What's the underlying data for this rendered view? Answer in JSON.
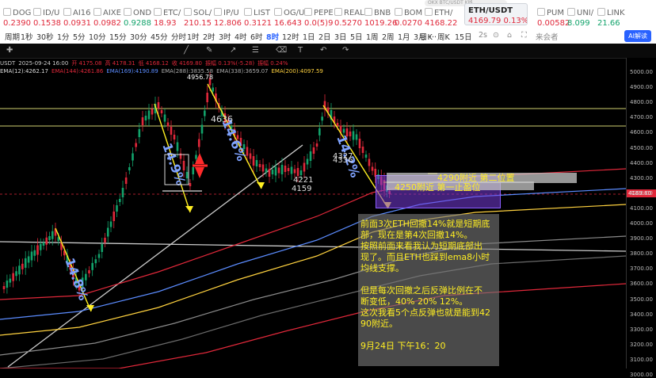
{
  "tickers": [
    {
      "sym": "DOG",
      "price": "0.2390",
      "dir": "dn"
    },
    {
      "sym": "ID/U",
      "price": "0.1538",
      "dir": "dn"
    },
    {
      "sym": "AI16",
      "price": "0.0931",
      "dir": "dn"
    },
    {
      "sym": "AIXE",
      "price": "0.0982",
      "dir": "dn"
    },
    {
      "sym": "OND",
      "price": "0.9288",
      "dir": "up"
    },
    {
      "sym": "ETC/",
      "price": "18.93",
      "dir": "dn"
    },
    {
      "sym": "SOL/",
      "price": "210.15",
      "dir": "dn"
    },
    {
      "sym": "IP/U",
      "price": "12.806",
      "dir": "dn"
    },
    {
      "sym": "LIST",
      "price": "0.3121",
      "dir": "dn"
    },
    {
      "sym": "OG/U",
      "price": "16.643",
      "dir": "dn"
    },
    {
      "sym": "PEPE",
      "price": "0.0(5)9",
      "dir": "dn"
    },
    {
      "sym": "REAL",
      "price": "0.5270",
      "dir": "dn"
    },
    {
      "sym": "BNB",
      "price": "1019.26",
      "dir": "dn"
    },
    {
      "sym": "BOM",
      "price": "0.0270",
      "dir": "dn"
    },
    {
      "sym": "ETH/",
      "price": "4168.22",
      "dir": "dn"
    },
    {
      "sym": "ETH/USDT",
      "price": "4169.79",
      "change": "0.13%",
      "dir": "dn",
      "active": true
    },
    {
      "sym": "PUM",
      "price": "0.00582",
      "dir": "dn"
    },
    {
      "sym": "UNI/",
      "price": "8.099",
      "dir": "up"
    },
    {
      "sym": "LINK",
      "price": "21.66",
      "dir": "up"
    }
  ],
  "url_hint": "OKX BTC/USDT K线",
  "toolbar": {
    "items": [
      "周期",
      "1秒",
      "30秒",
      "1分",
      "5分",
      "10分",
      "15分",
      "30分",
      "45分",
      "分时",
      "1时",
      "2时",
      "3时",
      "4时",
      "6时",
      "8时",
      "12时",
      "1日",
      "2日",
      "3日",
      "5日",
      "1周",
      "2周",
      "1月",
      "3月",
      "..."
    ],
    "items2": [
      "日K",
      "周K",
      "15日"
    ],
    "selected": "8时",
    "right": [
      "2s",
      "⊙",
      "⌂",
      "⛶",
      "来会者"
    ],
    "ai": "AI解读"
  },
  "info": {
    "line1": [
      "USDT",
      "2025-09-24 16:00",
      "开 4175.08",
      "高 4178.31",
      "低 4168.12",
      "收 4169.80",
      "振幅 0.13%(-5.28)",
      "振幅 0.24%"
    ],
    "line2": [
      "EMA(12):4262.17",
      "EMA(144):4261.86",
      "EMA(169):4190.89",
      "EMA(288):3835.58",
      "EMA(338):3659.07",
      "EMA(200):4097.59"
    ]
  },
  "axis": {
    "labels": [
      "5000.00",
      "4900.00",
      "4800.00",
      "4700.00",
      "4600.00",
      "4500.00",
      "4400.00",
      "4300.00",
      "4200.00",
      "4100.00",
      "4000.00",
      "3900.00",
      "3800.00",
      "3700.00",
      "3600.00",
      "3500.00",
      "3400.00",
      "3300.00",
      "3200.00",
      "3100.00",
      "3000.00"
    ],
    "current": "4169.80"
  },
  "annotations": {
    "peak": "4956.78",
    "mid_price": "4636",
    "low1": "4221",
    "low2": "4159",
    "mid2": "4327",
    "mid3": "4336",
    "pct1": "14.8%",
    "pct2": "14.9%",
    "pct3": "14.6%",
    "pct4": "14.2%",
    "target1": "4290附近 第二位置",
    "target2": "4250附近 第一止盈位"
  },
  "note": {
    "lines": [
      "前面3次ETH回撤14%就是短期底",
      "部，现在是第4次回撤14%。",
      "按照前面来看我认为短期底部出",
      "现了。而且ETH也踩到ema8小时",
      "均线支撑。",
      "",
      "但是每次回撤之后反弹比例在不",
      "断变低，40% 20% 12%。",
      "这次我看5个点反弹也就是能到42",
      "90附近。",
      "",
      "9月24日 下午16：20"
    ]
  },
  "colors": {
    "up": "#12a36b",
    "down": "#e0283a",
    "note": "#ffee22"
  }
}
